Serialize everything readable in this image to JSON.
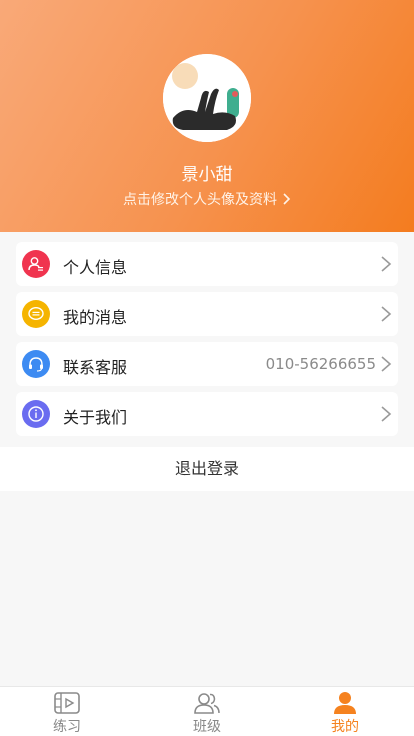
{
  "profile": {
    "name": "景小甜",
    "edit_text": "点击修改个人头像及资料",
    "chevron": "›"
  },
  "menu": [
    {
      "label": "个人信息",
      "icon": "user-icon",
      "color": "#f0344f",
      "value": ""
    },
    {
      "label": "我的消息",
      "icon": "message-icon",
      "color": "#f5b400",
      "value": ""
    },
    {
      "label": "联系客服",
      "icon": "headset-icon",
      "color": "#3d8bf2",
      "value": "010-56266655"
    },
    {
      "label": "关于我们",
      "icon": "info-icon",
      "color": "#6a6cf0",
      "value": ""
    }
  ],
  "logout_label": "退出登录",
  "tabs": [
    {
      "label": "练习",
      "icon": "video-icon",
      "active": false
    },
    {
      "label": "班级",
      "icon": "group-icon",
      "active": false
    },
    {
      "label": "我的",
      "icon": "person-icon",
      "active": true
    }
  ],
  "colors": {
    "accent": "#f5821f",
    "header_start": "#f9a978",
    "header_end": "#f47c1f"
  }
}
